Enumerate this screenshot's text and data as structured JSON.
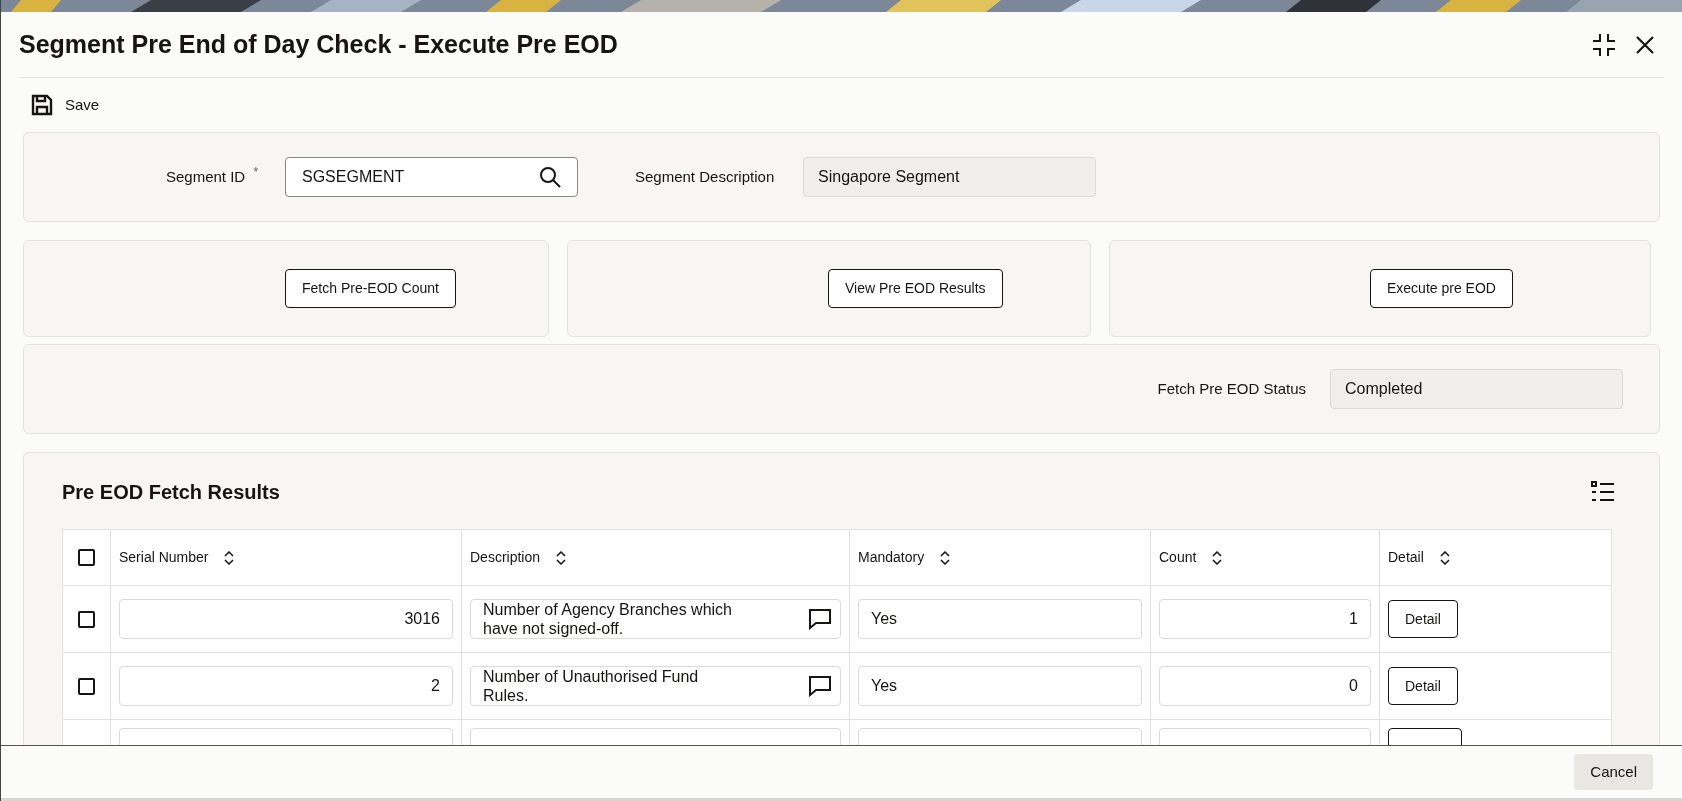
{
  "title": "Segment Pre End of Day Check - Execute Pre EOD",
  "toolbar": [
    {
      "label": "Save"
    }
  ],
  "segment": {
    "id_label": "Segment ID",
    "required_mark": "*",
    "id_value": "SGSEGMENT",
    "description_label": "Segment Description",
    "description_value": "Singapore Segment"
  },
  "actions": [
    "Fetch Pre-EOD Count",
    "View Pre EOD Results",
    "Execute pre EOD"
  ],
  "status": {
    "label": "Fetch Pre EOD Status",
    "value": "Completed"
  },
  "results": {
    "title": "Pre EOD Fetch Results",
    "header_checked": false,
    "columns": [
      "Serial Number",
      "Description",
      "Mandatory",
      "Count",
      "Detail"
    ],
    "rows": [
      {
        "checked": false,
        "serial": "3016",
        "description": "Number of Agency Branches which have not signed-off.",
        "mandatory": "Yes",
        "count": "1",
        "detail": "Detail"
      },
      {
        "checked": false,
        "serial": "2",
        "description": "Number of Unauthorised Fund Rules.",
        "mandatory": "Yes",
        "count": "0",
        "detail": "Detail"
      }
    ]
  },
  "footer": {
    "buttons": [
      "Cancel"
    ]
  }
}
